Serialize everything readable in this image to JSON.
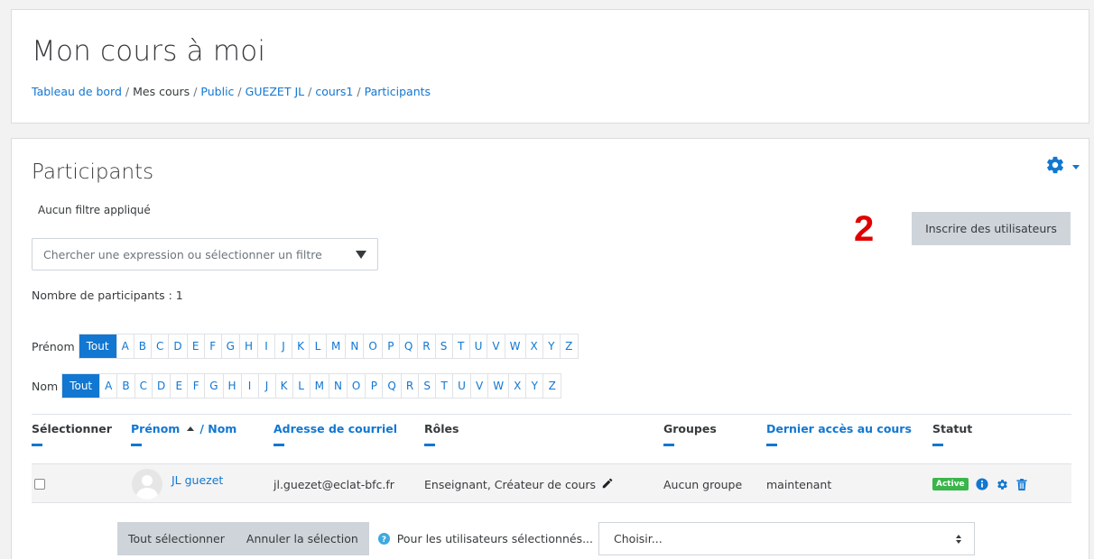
{
  "header": {
    "course_title": "Mon cours à moi",
    "breadcrumb": [
      {
        "label": "Tableau de bord",
        "link": true
      },
      {
        "label": "Mes cours",
        "link": false
      },
      {
        "label": "Public",
        "link": true
      },
      {
        "label": "GUEZET JL",
        "link": true
      },
      {
        "label": "cours1",
        "link": true
      },
      {
        "label": "Participants",
        "link": true
      }
    ]
  },
  "main": {
    "title": "Participants",
    "filter_note": "Aucun filtre appliqué",
    "filter_placeholder": "Chercher une expression ou sélectionner un filtre",
    "annotation_number": "2",
    "enrol_button": "Inscrire des utilisateurs",
    "participant_count": "Nombre de participants : 1",
    "initials": {
      "first_label": "Prénom",
      "last_label": "Nom",
      "all": "Tout",
      "letters": [
        "A",
        "B",
        "C",
        "D",
        "E",
        "F",
        "G",
        "H",
        "I",
        "J",
        "K",
        "L",
        "M",
        "N",
        "O",
        "P",
        "Q",
        "R",
        "S",
        "T",
        "U",
        "V",
        "W",
        "X",
        "Y",
        "Z"
      ]
    },
    "table": {
      "headers": {
        "select": "Sélectionner",
        "firstname": "Prénom",
        "slash_lastname": "/ Nom",
        "email": "Adresse de courriel",
        "roles": "Rôles",
        "groups": "Groupes",
        "last_access": "Dernier accès au cours",
        "status": "Statut"
      },
      "rows": [
        {
          "name": "JL guezet",
          "email": "jl.guezet@eclat-bfc.fr",
          "roles": "Enseignant, Créateur de cours",
          "groups": "Aucun groupe",
          "last_access": "maintenant",
          "status": "Active"
        }
      ]
    },
    "bulk": {
      "select_all": "Tout sélectionner",
      "deselect": "Annuler la sélection",
      "label": "Pour les utilisateurs sélectionnés...",
      "choose": "Choisir..."
    }
  },
  "colors": {
    "link": "#1177d1",
    "annotation": "#e00000",
    "active_badge": "#39b54a",
    "button_grey": "#ced4da"
  }
}
